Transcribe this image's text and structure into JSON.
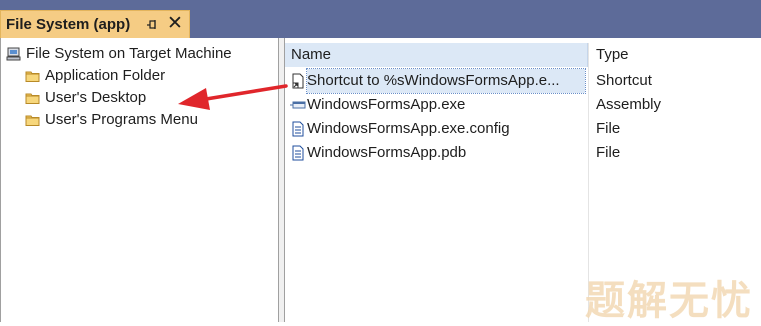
{
  "panel": {
    "title": "File System (app)",
    "pin_icon": "pin-icon",
    "close_label": "✕"
  },
  "tree": {
    "items": [
      {
        "label": "File System on Target Machine",
        "icon": "computer-icon"
      },
      {
        "label": "Application Folder",
        "icon": "folder-icon"
      },
      {
        "label": "User's Desktop",
        "icon": "folder-icon"
      },
      {
        "label": "User's Programs Menu",
        "icon": "folder-icon"
      }
    ]
  },
  "list": {
    "columns": [
      "Name",
      "Type"
    ],
    "rows": [
      {
        "name": "Shortcut to %sWindowsFormsApp.e...",
        "type": "Shortcut",
        "icon": "shortcut-icon",
        "selected": true
      },
      {
        "name": "WindowsFormsApp.exe",
        "type": "Assembly",
        "icon": "assembly-icon",
        "selected": false
      },
      {
        "name": "WindowsFormsApp.exe.config",
        "type": "File",
        "icon": "file-icon",
        "selected": false
      },
      {
        "name": "WindowsFormsApp.pdb",
        "type": "File",
        "icon": "file-icon",
        "selected": false
      }
    ]
  },
  "annotation": {
    "arrow_color": "#e0262b"
  },
  "watermark": {
    "text": "题解无忧"
  },
  "colors": {
    "tab_bar": "#5d6b99",
    "active_tab": "#f5cc84",
    "selection": "#dce8f6"
  }
}
